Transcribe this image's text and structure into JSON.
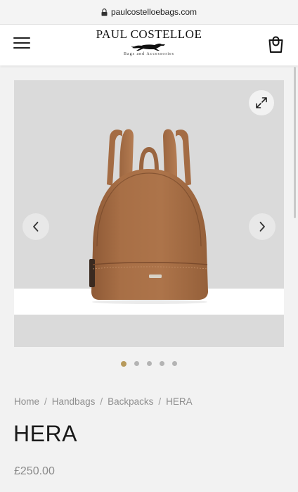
{
  "browser": {
    "url": "paulcostelloebags.com",
    "lock_icon": "lock-icon"
  },
  "header": {
    "brand": "PAUL COSTELLOE",
    "tagline": "Bags and Accessories",
    "menu_icon": "hamburger-menu-icon",
    "cart_icon": "shopping-bag-icon"
  },
  "gallery": {
    "product": "backpack",
    "expand_icon": "expand-icon",
    "prev_icon": "chevron-left-icon",
    "next_icon": "chevron-right-icon",
    "slide_count": 5,
    "active_slide": 1,
    "active_dot_color": "#b79a5c",
    "bag_color": "#a26a42"
  },
  "breadcrumb": {
    "items": [
      "Home",
      "Handbags",
      "Backpacks",
      "HERA"
    ],
    "separator": "/"
  },
  "product": {
    "title": "HERA",
    "price": "£250.00"
  }
}
